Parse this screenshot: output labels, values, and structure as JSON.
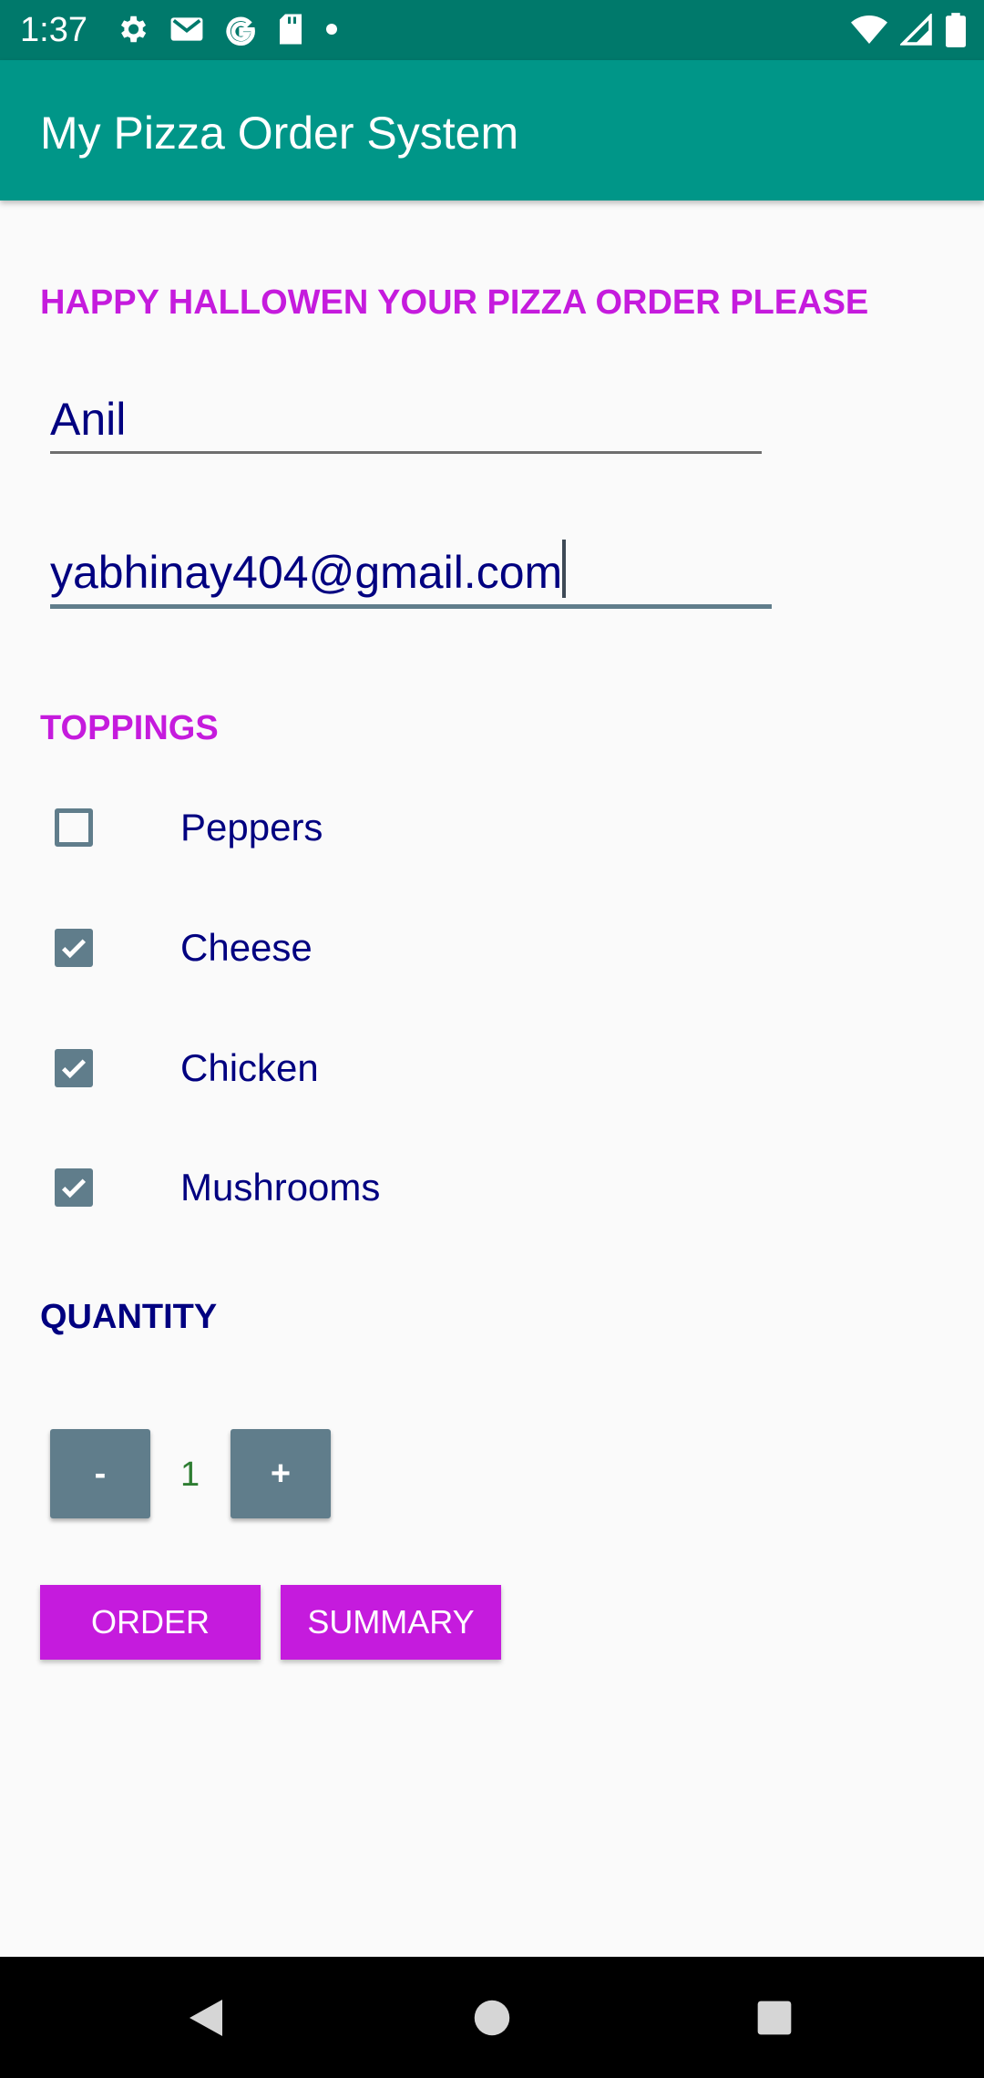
{
  "status_bar": {
    "time": "1:37",
    "left_icons": [
      "gear-icon",
      "gmail-icon",
      "google-icon",
      "sd-card-icon",
      "dot-icon"
    ],
    "right_icons": [
      "wifi-icon",
      "signal-icon",
      "battery-icon"
    ]
  },
  "app_bar": {
    "title": "My Pizza Order System"
  },
  "greeting": "HAPPY HALLOWEN YOUR PIZZA ORDER PLEASE",
  "form": {
    "name_value": "Anil",
    "email_value": "yabhinay404@gmail.com"
  },
  "toppings": {
    "label": "TOPPINGS",
    "items": [
      {
        "label": "Peppers",
        "checked": false
      },
      {
        "label": "Cheese",
        "checked": true
      },
      {
        "label": "Chicken",
        "checked": true
      },
      {
        "label": "Mushrooms",
        "checked": true
      }
    ]
  },
  "quantity": {
    "label": "QUANTITY",
    "minus_label": "-",
    "plus_label": "+",
    "value": "1"
  },
  "actions": {
    "order_label": "ORDER",
    "summary_label": "SUMMARY"
  },
  "colors": {
    "status_bar": "#00796B",
    "app_bar": "#009688",
    "accent": "#C51BDD",
    "text_navy": "#000080",
    "control_grey": "#607D8B",
    "quantity_green": "#2E7D32"
  },
  "nav_bar": {
    "icons": [
      "back-icon",
      "home-icon",
      "recents-icon"
    ]
  }
}
